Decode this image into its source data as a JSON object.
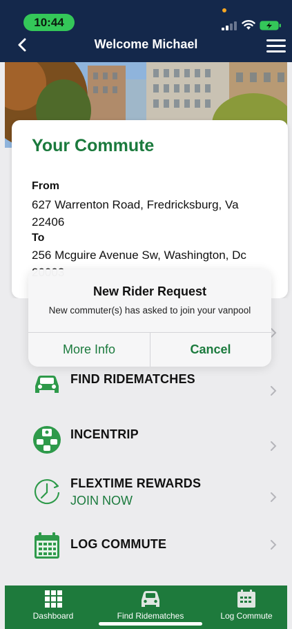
{
  "status_bar": {
    "time": "10:44"
  },
  "header": {
    "title": "Welcome Michael"
  },
  "card": {
    "title": "Your Commute",
    "from_label": "From",
    "from_address": "627 Warrenton Road, Fredricksburg, Va 22406",
    "to_label": "To",
    "to_address": "256 Mcguire Avenue Sw, Washington, Dc 20003"
  },
  "alert": {
    "title": "New Rider Request",
    "message": "New commuter(s) has asked to join your vanpool",
    "more_info_label": "More Info",
    "cancel_label": "Cancel"
  },
  "menu": {
    "items": [
      {
        "label": "FIND RIDEMATCHES",
        "icon": "car-icon"
      },
      {
        "label": "INCENTRIP",
        "icon": "incentrip-icon"
      },
      {
        "label": "FLEXTIME REWARDS",
        "sub": "JOIN NOW",
        "icon": "clock-icon"
      },
      {
        "label": "LOG COMMUTE",
        "icon": "calendar-icon"
      }
    ]
  },
  "tabbar": {
    "tabs": [
      {
        "label": "Dashboard",
        "icon": "grid-icon"
      },
      {
        "label": "Find Ridematches",
        "icon": "car-icon"
      },
      {
        "label": "Log Commute",
        "icon": "calendar-icon"
      }
    ]
  },
  "colors": {
    "header_bg": "#14284b",
    "brand_green": "#1b7a3d",
    "tabbar_bg": "#1e7a3c",
    "status_pill": "#34c759"
  }
}
